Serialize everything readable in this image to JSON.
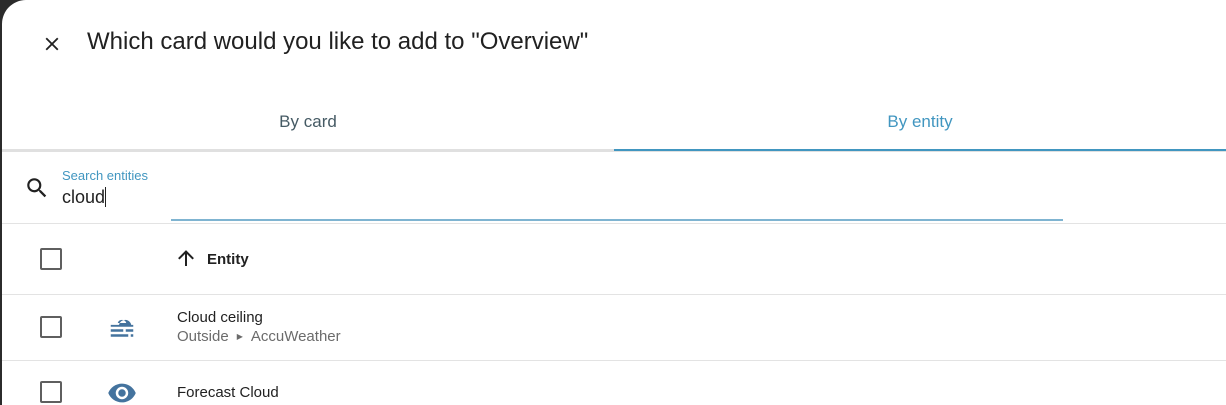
{
  "dialog": {
    "title": "Which card would you like to add to \"Overview\"",
    "close_icon": "close-icon"
  },
  "tabs": [
    {
      "label": "By card",
      "active": false
    },
    {
      "label": "By entity",
      "active": true
    }
  ],
  "search": {
    "label": "Search entities",
    "value": "cloud",
    "icon": "magnify-icon"
  },
  "table": {
    "columns": [
      {
        "label": "Entity",
        "sort": "ascending",
        "sort_icon": "arrow-up-icon"
      }
    ],
    "rows": [
      {
        "name": "Cloud ceiling",
        "area": "Outside",
        "integration": "AccuWeather",
        "icon": "weather-fog-icon",
        "checked": false
      },
      {
        "name": "Forecast Cloud",
        "icon": "eye-icon",
        "checked": false
      }
    ]
  },
  "colors": {
    "accent": "#4196c0",
    "icon": "#44739e",
    "text": "#212121",
    "secondary_text": "#6b6b6b"
  }
}
